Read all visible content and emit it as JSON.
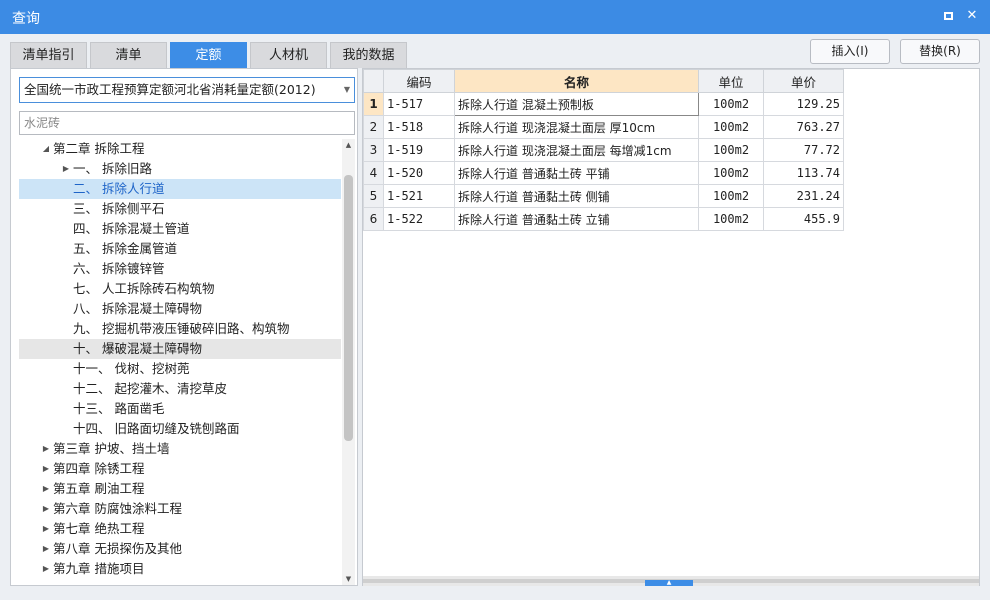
{
  "window": {
    "title": "查询"
  },
  "tabs": [
    {
      "label": "清单指引"
    },
    {
      "label": "清单"
    },
    {
      "label": "定额"
    },
    {
      "label": "人材机"
    },
    {
      "label": "我的数据"
    }
  ],
  "active_tab": "定额",
  "buttons": {
    "insert": "插入(I)",
    "replace": "替换(R)"
  },
  "left": {
    "library": "全国统一市政工程预算定额河北省消耗量定额(2012)",
    "search_value": "水泥砖",
    "tree": [
      {
        "label": "第二章 拆除工程",
        "expanded": true
      },
      {
        "label": "一、 拆除旧路",
        "expandable": true
      },
      {
        "label": "二、 拆除人行道",
        "selected": true
      },
      {
        "label": "三、 拆除侧平石"
      },
      {
        "label": "四、 拆除混凝土管道"
      },
      {
        "label": "五、 拆除金属管道"
      },
      {
        "label": "六、 拆除镀锌管"
      },
      {
        "label": "七、 人工拆除砖石构筑物"
      },
      {
        "label": "八、 拆除混凝土障碍物"
      },
      {
        "label": "九、 挖掘机带液压锤破碎旧路、构筑物"
      },
      {
        "label": "十、 爆破混凝土障碍物",
        "hover": true
      },
      {
        "label": "十一、 伐树、挖树蔸"
      },
      {
        "label": "十二、 起挖灌木、清挖草皮"
      },
      {
        "label": "十三、 路面凿毛"
      },
      {
        "label": "十四、 旧路面切缝及铣刨路面"
      },
      {
        "label": "第三章 护坡、挡土墙",
        "expandable": true
      },
      {
        "label": "第四章 除锈工程",
        "expandable": true
      },
      {
        "label": "第五章 刷油工程",
        "expandable": true
      },
      {
        "label": "第六章 防腐蚀涂料工程",
        "expandable": true
      },
      {
        "label": "第七章 绝热工程",
        "expandable": true
      },
      {
        "label": "第八章 无损探伤及其他",
        "expandable": true
      },
      {
        "label": "第九章 措施项目",
        "expandable": true
      }
    ]
  },
  "grid": {
    "headers": {
      "code": "编码",
      "name": "名称",
      "unit": "单位",
      "price": "单价"
    },
    "rows": [
      {
        "no": "1",
        "code": "1-517",
        "name": "拆除人行道 混凝土预制板",
        "unit": "100m2",
        "price": "129.25"
      },
      {
        "no": "2",
        "code": "1-518",
        "name": "拆除人行道 现浇混凝土面层 厚10cm",
        "unit": "100m2",
        "price": "763.27"
      },
      {
        "no": "3",
        "code": "1-519",
        "name": "拆除人行道 现浇混凝土面层 每增减1cm",
        "unit": "100m2",
        "price": "77.72"
      },
      {
        "no": "4",
        "code": "1-520",
        "name": "拆除人行道 普通黏土砖 平铺",
        "unit": "100m2",
        "price": "113.74"
      },
      {
        "no": "5",
        "code": "1-521",
        "name": "拆除人行道 普通黏土砖 侧铺",
        "unit": "100m2",
        "price": "231.24"
      },
      {
        "no": "6",
        "code": "1-522",
        "name": "拆除人行道 普通黏土砖 立铺",
        "unit": "100m2",
        "price": "455.9"
      }
    ]
  }
}
